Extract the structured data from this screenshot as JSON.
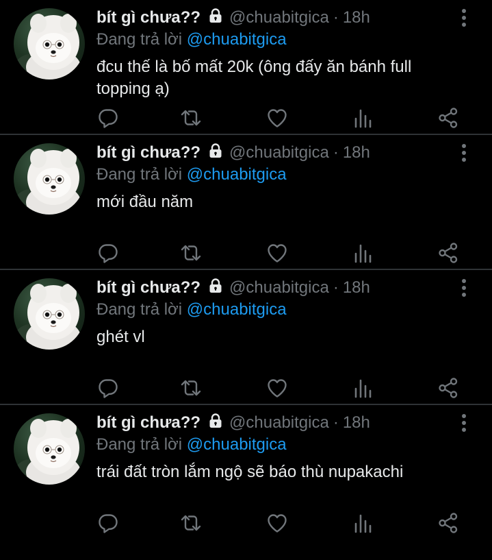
{
  "colors": {
    "background": "#000000",
    "primary_text": "#e7e9ea",
    "secondary_text": "#71767b",
    "link": "#1d9bf0",
    "divider": "#2f3336"
  },
  "tweets": [
    {
      "display_name": "bít gì chưa??",
      "handle": "@chuabitgica",
      "separator": "·",
      "time": "18h",
      "replying_prefix": "Đang trả lời",
      "replying_to": "@chuabitgica",
      "text": "đcu thế là bố mất 20k (ông đấy ăn bánh full topping ạ)"
    },
    {
      "display_name": "bít gì chưa??",
      "handle": "@chuabitgica",
      "separator": "·",
      "time": "18h",
      "replying_prefix": "Đang trả lời",
      "replying_to": "@chuabitgica",
      "text": "mới đầu năm"
    },
    {
      "display_name": "bít gì chưa??",
      "handle": "@chuabitgica",
      "separator": "·",
      "time": "18h",
      "replying_prefix": "Đang trả lời",
      "replying_to": "@chuabitgica",
      "text": "ghét vl"
    },
    {
      "display_name": "bít gì chưa??",
      "handle": "@chuabitgica",
      "separator": "·",
      "time": "18h",
      "replying_prefix": "Đang trả lời",
      "replying_to": "@chuabitgica",
      "text": "trái đất tròn lắm ngộ sẽ báo thù nupakachi"
    }
  ],
  "icons": {
    "lock": "lock-icon",
    "more": "more-vertical-icon",
    "reply": "reply-icon",
    "retweet": "retweet-icon",
    "like": "heart-icon",
    "views": "views-icon",
    "share": "share-icon"
  }
}
